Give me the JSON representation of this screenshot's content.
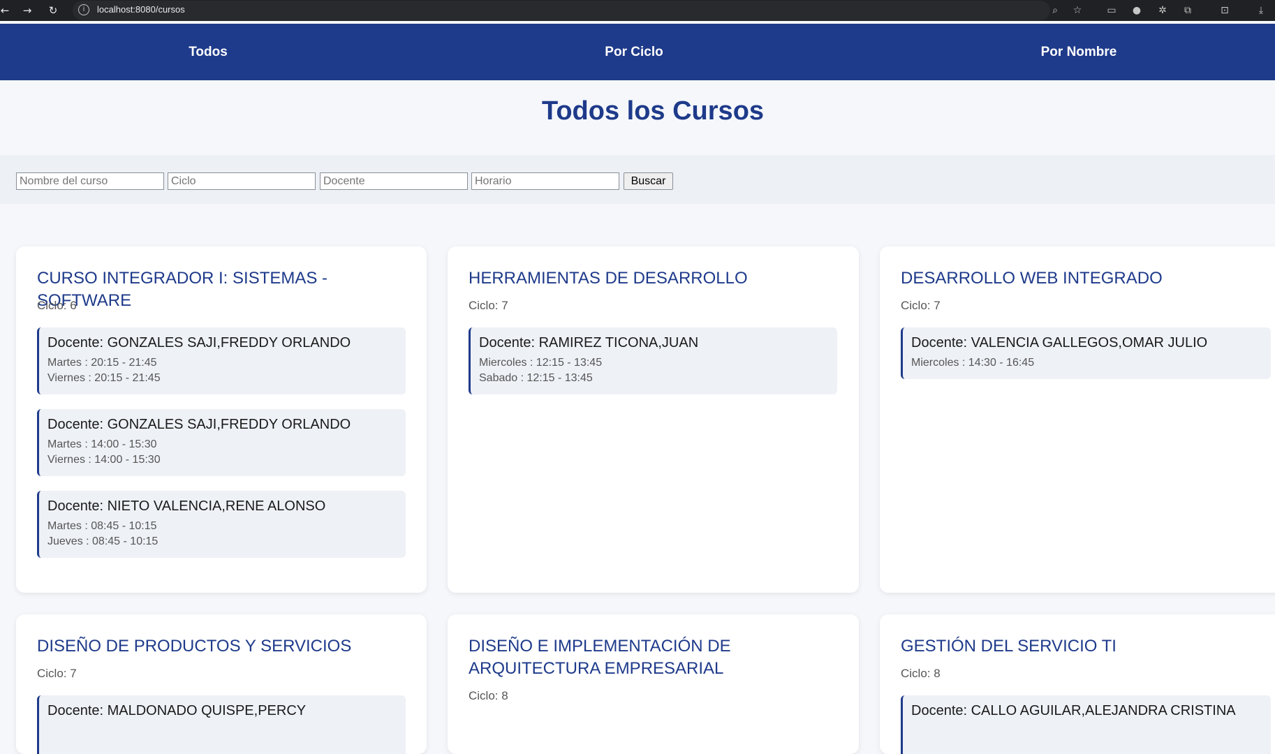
{
  "browser": {
    "url": "localhost:8080/cursos"
  },
  "nav": {
    "items": [
      "Todos",
      "Por Ciclo",
      "Por Nombre"
    ]
  },
  "page": {
    "title": "Todos los Cursos"
  },
  "search": {
    "nombre_placeholder": "Nombre del curso",
    "ciclo_placeholder": "Ciclo",
    "docente_placeholder": "Docente",
    "horario_placeholder": "Horario",
    "button_label": "Buscar"
  },
  "courses": [
    {
      "name": "CURSO INTEGRADOR I: SISTEMAS - SOFTWARE",
      "ciclo": "Ciclo: 6",
      "teachers": [
        {
          "docente": "Docente: GONZALES SAJI,FREDDY ORLANDO",
          "horarios": [
            "Martes : 20:15 - 21:45",
            "Viernes : 20:15 - 21:45"
          ]
        },
        {
          "docente": "Docente: GONZALES SAJI,FREDDY ORLANDO",
          "horarios": [
            "Martes : 14:00 - 15:30",
            "Viernes : 14:00 - 15:30"
          ]
        },
        {
          "docente": "Docente: NIETO VALENCIA,RENE ALONSO",
          "horarios": [
            "Martes : 08:45 - 10:15",
            "Jueves : 08:45 - 10:15"
          ]
        }
      ]
    },
    {
      "name": "HERRAMIENTAS DE DESARROLLO",
      "ciclo": "Ciclo: 7",
      "teachers": [
        {
          "docente": "Docente: RAMIREZ TICONA,JUAN",
          "horarios": [
            "Miercoles : 12:15 - 13:45",
            "Sabado : 12:15 - 13:45"
          ]
        }
      ]
    },
    {
      "name": "DESARROLLO WEB INTEGRADO",
      "ciclo": "Ciclo: 7",
      "teachers": [
        {
          "docente": "Docente: VALENCIA GALLEGOS,OMAR JULIO",
          "horarios": [
            "Miercoles : 14:30 - 16:45"
          ]
        }
      ]
    },
    {
      "name": "DISEÑO DE PRODUCTOS Y SERVICIOS",
      "ciclo": "Ciclo: 7",
      "teachers": [
        {
          "docente": "Docente: MALDONADO QUISPE,PERCY",
          "horarios": []
        }
      ]
    },
    {
      "name_line1": "DISEÑO E IMPLEMENTACIÓN DE",
      "name_line2": "ARQUITECTURA EMPRESARIAL",
      "ciclo": "Ciclo: 8",
      "teachers": []
    },
    {
      "name": "GESTIÓN DEL SERVICIO TI",
      "ciclo": "Ciclo: 8",
      "teachers": [
        {
          "docente": "Docente: CALLO AGUILAR,ALEJANDRA CRISTINA",
          "horarios": []
        }
      ]
    }
  ],
  "icons": {
    "back": "arrow-left-icon",
    "forward": "arrow-right-icon",
    "reload": "reload-icon",
    "site_info": "info-icon",
    "zoom": "zoom-icon",
    "bookmark": "star-icon",
    "download": "download-icon"
  }
}
